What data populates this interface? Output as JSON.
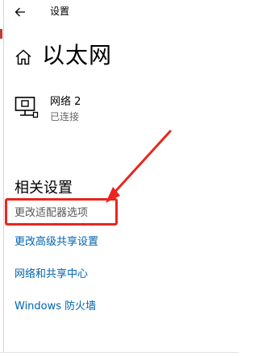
{
  "header": {
    "back_icon": "back-arrow-icon",
    "title": "设置"
  },
  "page": {
    "home_icon": "home-icon",
    "title": "以太网"
  },
  "network": {
    "icon": "ethernet-monitor-icon",
    "name": "网络 2",
    "status": "已连接"
  },
  "related": {
    "heading": "相关设置",
    "links": [
      {
        "label": "更改适配器选项"
      },
      {
        "label": "更改高级共享设置"
      },
      {
        "label": "网络和共享中心"
      },
      {
        "label": "Windows 防火墙"
      }
    ]
  },
  "annotation": {
    "highlight_color": "#e8261f",
    "arrow_color": "#e8261f"
  },
  "colors": {
    "link": "#0063b1",
    "secondary_text": "#666666",
    "background": "#ffffff"
  }
}
